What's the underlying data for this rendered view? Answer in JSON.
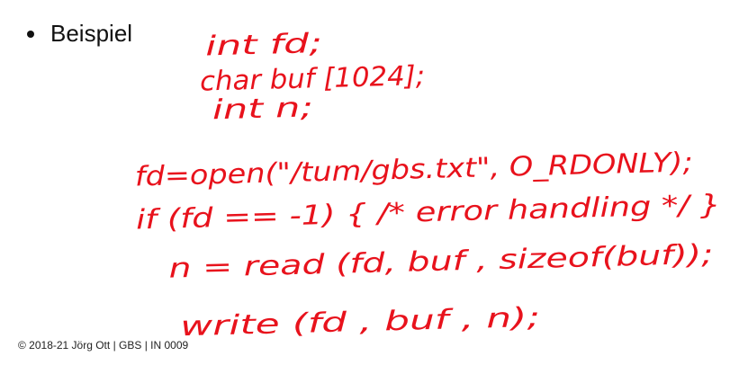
{
  "slide": {
    "bullet": "Beispiel",
    "footer": "© 2018-21 Jörg Ott | GBS | IN 0009",
    "ink_color": "#e8121c"
  },
  "handwriting": {
    "lines": [
      "int fd;",
      "char buf [1024];",
      "int n;",
      "fd=open(\"/tum/gbs.txt\", O_RDONLY);",
      "if (fd == -1) { /* error handling */ }",
      "n = read (fd, buf , sizeof(buf));",
      "write (fd , buf , n);"
    ]
  }
}
